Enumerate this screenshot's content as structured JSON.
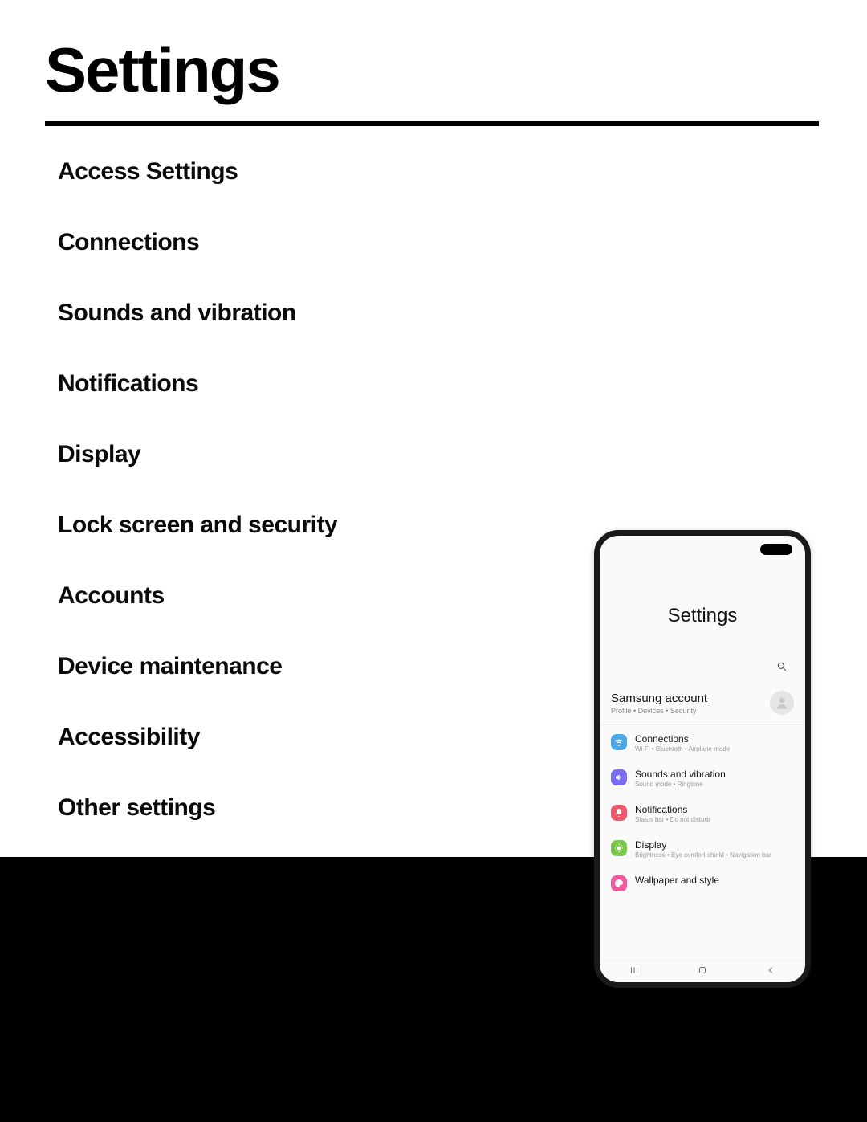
{
  "page": {
    "title": "Settings"
  },
  "toc": [
    "Access Settings",
    "Connections",
    "Sounds and vibration",
    "Notifications",
    "Display",
    "Lock screen and security",
    "Accounts",
    "Device maintenance",
    "Accessibility",
    "Other settings"
  ],
  "phone": {
    "header": "Settings",
    "account": {
      "title": "Samsung account",
      "sub": "Profile  •  Devices  •  Security"
    },
    "rows": [
      {
        "icon": "wifi-icon",
        "color": "#4aa8e8",
        "title": "Connections",
        "sub": "Wi-Fi  •  Bluetooth  •  Airplane mode"
      },
      {
        "icon": "sound-icon",
        "color": "#7a6cf0",
        "title": "Sounds and vibration",
        "sub": "Sound mode  •  Ringtone"
      },
      {
        "icon": "bell-icon",
        "color": "#ef5a6f",
        "title": "Notifications",
        "sub": "Status bar  •  Do not disturb"
      },
      {
        "icon": "display-icon",
        "color": "#7ac74f",
        "title": "Display",
        "sub": "Brightness  •  Eye comfort shield  •  Navigation bar"
      },
      {
        "icon": "palette-icon",
        "color": "#ef5a9f",
        "title": "Wallpaper and style",
        "sub": ""
      }
    ],
    "nav": {
      "recents": "|||",
      "home": "○",
      "back": "‹"
    }
  }
}
